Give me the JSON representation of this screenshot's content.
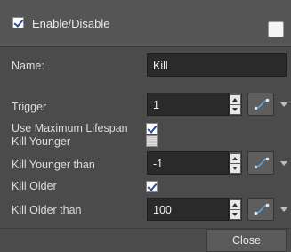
{
  "header": {
    "enable_label": "Enable/Disable",
    "enable_checked": true,
    "swatch_color": "#f4f4f4"
  },
  "fields": {
    "name_label": "Name:",
    "name_value": "Kill",
    "trigger_label": "Trigger",
    "trigger_value": "1",
    "use_max_lifespan_label": "Use Maximum Lifespan",
    "use_max_lifespan_checked": true,
    "kill_younger_label": "Kill Younger",
    "kill_younger_checked": false,
    "kill_younger_than_label": "Kill Younger than",
    "kill_younger_than_value": "-1",
    "kill_older_label": "Kill Older",
    "kill_older_checked": true,
    "kill_older_than_label": "Kill Older than",
    "kill_older_than_value": "100"
  },
  "footer": {
    "close_label": "Close"
  },
  "icons": {
    "function": "function-curve-icon",
    "menu": "chevron-down-icon",
    "spin_up": "arrow-up-icon",
    "spin_down": "arrow-down-icon"
  },
  "colors": {
    "panel_bg": "#4b4b4b",
    "field_bg": "#2a2a2a",
    "function_curve": "#4fa8e8"
  }
}
